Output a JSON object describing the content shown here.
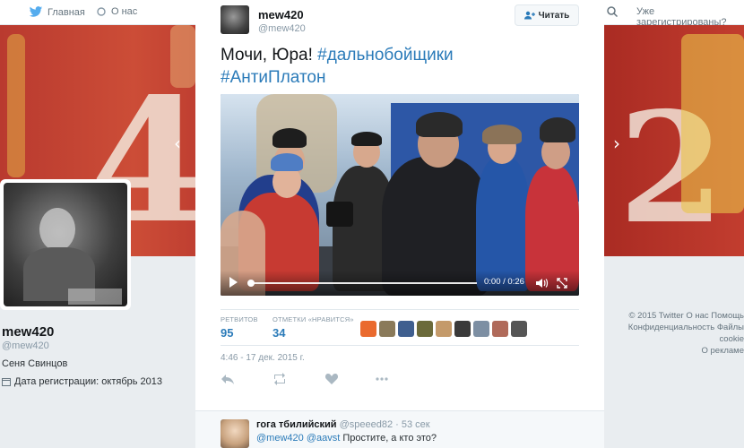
{
  "nav": {
    "home_label": "Главная",
    "about_label": "О нас",
    "already_registered": "Уже зарегистрированы? Войти"
  },
  "profile": {
    "name": "mew420",
    "handle": "@mew420",
    "real_name": "Сеня Свинцов",
    "joined": "Дата регистрации: октябрь 2013"
  },
  "footer": {
    "links": [
      "© 2015 Twitter",
      "О нас",
      "Помощь",
      "Конфиденциальность",
      "Файлы cookie",
      "О рекламе"
    ]
  },
  "tweet": {
    "author_name": "mew420",
    "author_handle": "@mew420",
    "follow_label": "Читать",
    "text_plain": "Мочи, Юра! ",
    "hashtag1": "#дальнобойщики",
    "hashtag2": "#АнтиПлатон",
    "video": {
      "time": "0:00 / 0:26",
      "progress": 0.0
    },
    "retweets_label": "РЕТВИТОВ",
    "retweets": "95",
    "likes_label": "ОТМЕТКИ «НРАВИТСЯ»",
    "likes": "34",
    "date": "4:46 - 17 дек. 2015 г."
  },
  "reply": {
    "name": "гога тбилийский",
    "handle": "@speeed82",
    "time": "· 53 сек",
    "mention1": "@mew420",
    "mention2": "@aavst",
    "text": " Простите, а кто это?"
  },
  "colors": {
    "link": "#2b7bb9",
    "bg": "#e9edf0"
  }
}
